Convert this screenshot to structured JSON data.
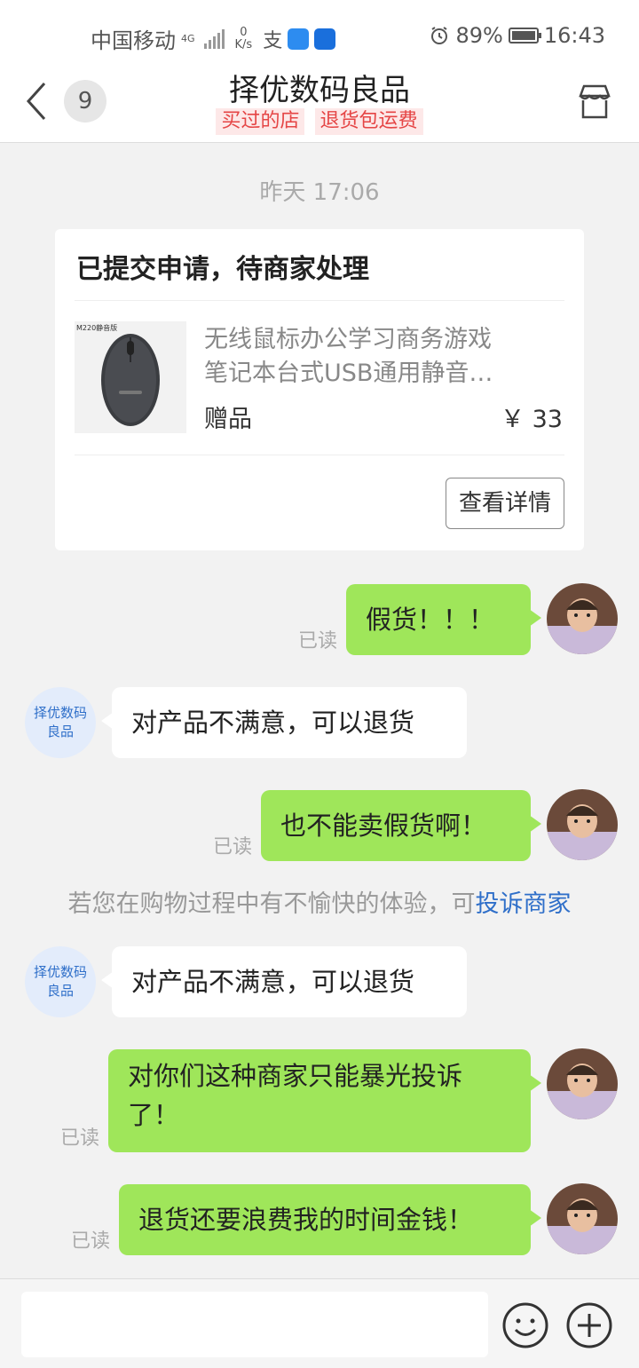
{
  "status_bar": {
    "carrier": "中国移动",
    "network_type": "4G",
    "net_speed_value": "0",
    "net_speed_unit": "K/s",
    "battery": "89%",
    "time": "16:43"
  },
  "header": {
    "unread_count": "9",
    "shop_name": "择优数码良品",
    "tags": [
      "买过的店",
      "退货包运费"
    ]
  },
  "chat": {
    "timestamp": "昨天 17:06",
    "refund_card": {
      "status_title": "已提交申请，待商家处理",
      "thumb_label": "M220静音版",
      "product_name_line1": "无线鼠标办公学习商务游戏",
      "product_name_line2": "笔记本台式USB通用静音…",
      "gift_label": "赠品",
      "price": "￥ 33",
      "detail_button": "查看详情"
    },
    "seller_avatar_text": "择优数码良品",
    "read_label": "已读",
    "messages": [
      {
        "from": "me",
        "text": "假货！！！"
      },
      {
        "from": "seller",
        "text": "对产品不满意，可以退货"
      },
      {
        "from": "me",
        "text": "也不能卖假货啊！"
      },
      {
        "from": "seller",
        "text": "对产品不满意，可以退货"
      },
      {
        "from": "me",
        "text": "对你们这种商家只能暴光投诉了！"
      },
      {
        "from": "me",
        "text": "退货还要浪费我的时间金钱！"
      }
    ],
    "notice_text": "若您在购物过程中有不愉快的体验，可",
    "notice_link": "投诉商家"
  },
  "input_bar": {
    "placeholder": ""
  },
  "colors": {
    "my_bubble": "#9fe65a",
    "link": "#2f6fc9",
    "tag_text": "#e54545"
  }
}
